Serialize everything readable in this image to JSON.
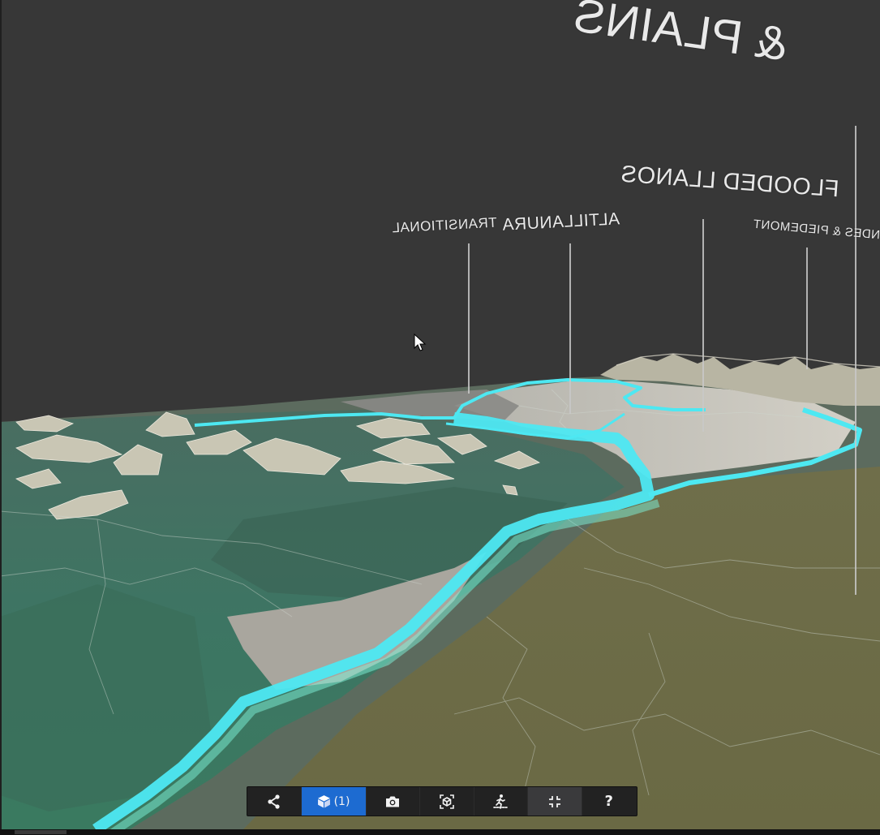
{
  "map": {
    "labels": {
      "regions_partial": "& PLAINS",
      "transitional": "TRANSITIONAL",
      "altillanura": "ALTILLANURA",
      "flooded_llanos": "FLOODED LLANOS",
      "andes_piedemont": "ANDES & PIEDEMONT"
    },
    "colors": {
      "sky": "#373737",
      "river": "#4de8f2",
      "terrain_green": "#3f7a68",
      "terrain_olive": "#6e6d47",
      "terrain_light": "#cfcbbf"
    }
  },
  "toolbar": {
    "share_icon": "share-icon",
    "layers_icon": "cube-icon",
    "layers_count": "(1)",
    "camera_icon": "camera-icon",
    "focus_icon": "focus-frame-icon",
    "walk_icon": "walking-person-icon",
    "fullscreen_icon": "exit-fullscreen-icon",
    "help_label": "?"
  }
}
